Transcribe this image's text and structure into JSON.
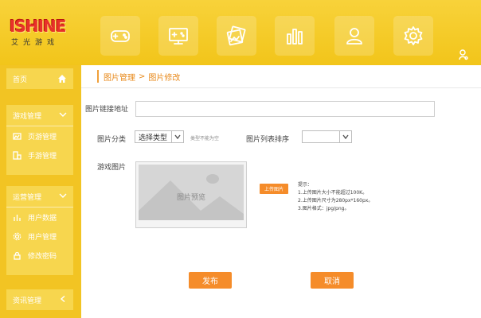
{
  "brand": {
    "name": "ISHINE",
    "subtitle": "艾光游戏"
  },
  "topnav": [
    {
      "id": "games",
      "icon": "gamepad-icon"
    },
    {
      "id": "console",
      "icon": "monitor-icon"
    },
    {
      "id": "images",
      "icon": "photos-icon"
    },
    {
      "id": "stats",
      "icon": "bar-chart-icon"
    },
    {
      "id": "users",
      "icon": "user-icon"
    },
    {
      "id": "settings",
      "icon": "gear-icon"
    }
  ],
  "sidebar": {
    "home_label": "首页",
    "game_mgmt": {
      "title": "游戏管理",
      "items": [
        {
          "label": "页游管理"
        },
        {
          "label": "手游管理"
        }
      ]
    },
    "ops_mgmt": {
      "title": "运营管理",
      "items": [
        {
          "label": "用户数据"
        },
        {
          "label": "用户管理"
        },
        {
          "label": "修改密码"
        }
      ]
    },
    "news_mgmt": {
      "title": "资讯管理"
    }
  },
  "breadcrumb": {
    "parent": "图片管理",
    "separator": ">",
    "current": "图片修改"
  },
  "form": {
    "url_label": "图片链接地址",
    "url_value": "",
    "category_label": "图片分类",
    "category_value": "选择类型",
    "category_hint": "类型不能为空",
    "order_label": "图片列表排序",
    "order_value": "",
    "game_image_label": "游戏图片",
    "preview_text": "图片预览",
    "upload_label": "上传图片",
    "tips_title": "提示：",
    "tips": [
      "1.上传图片大小不能超过100K。",
      "2.上传图片尺寸为280px*160px。",
      "3.图片格式：jpg/png。"
    ]
  },
  "actions": {
    "publish": "发布",
    "cancel": "取消"
  },
  "colors": {
    "accent": "#f58c2a",
    "header": "#f2c51a",
    "sidebar": "#f2c423"
  }
}
